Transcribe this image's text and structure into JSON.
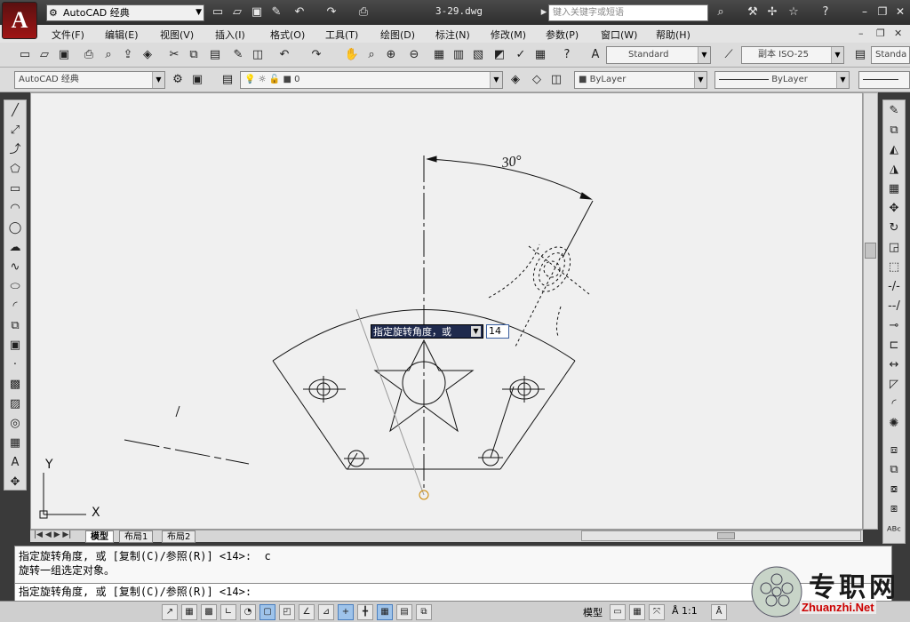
{
  "app": {
    "logo_letter": "A",
    "workspace": "AutoCAD 经典",
    "document_title": "3-29.dwg",
    "search_placeholder": "键入关键字或短语"
  },
  "menu": [
    "文件(F)",
    "编辑(E)",
    "视图(V)",
    "插入(I)",
    "格式(O)",
    "工具(T)",
    "绘图(D)",
    "标注(N)",
    "修改(M)",
    "参数(P)",
    "窗口(W)",
    "帮助(H)"
  ],
  "toolbar": {
    "text_style": "Standard",
    "dim_style": "副本 ISO-25",
    "table_style": "Standa",
    "workspace_combo": "AutoCAD 经典",
    "layer": "0",
    "color": "ByLayer",
    "linetype": "ByLayer"
  },
  "drawing": {
    "angle_label": "30°",
    "ucs_x": "X",
    "ucs_y": "Y"
  },
  "dynamic_input": {
    "prompt": "指定旋转角度，或",
    "value": "14"
  },
  "tabs": [
    "模型",
    "布局1",
    "布局2"
  ],
  "command": {
    "history": [
      "指定旋转角度, 或 [复制(C)/参照(R)] <14>:  c",
      "旋转一组选定对象。"
    ],
    "current": "指定旋转角度, 或 [复制(C)/参照(R)] <14>:"
  },
  "status": {
    "model_label": "模型",
    "scale": "1:1"
  },
  "watermark": {
    "brand": "专职网",
    "url": "Zhuanzhi.Net"
  }
}
